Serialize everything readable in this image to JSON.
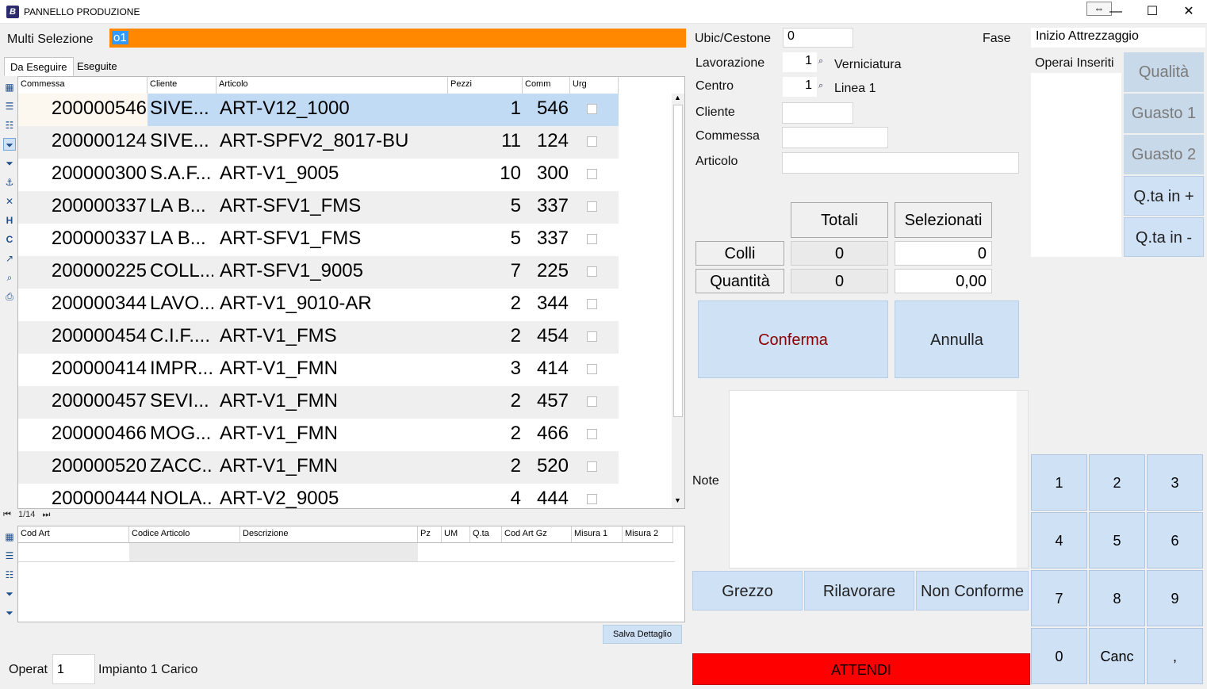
{
  "window": {
    "title": "PANNELLO PRODUZIONE",
    "app_icon_letter": "B",
    "resize_glyph": "⇔",
    "minimize_glyph": "—",
    "maximize_glyph": "☐",
    "close_glyph": "✕"
  },
  "multi": {
    "label": "Multi Selezione",
    "value": "o1",
    "bg_color": "#ff8800"
  },
  "tabs": [
    {
      "label": "Da Eseguire"
    },
    {
      "label": "Eseguite"
    }
  ],
  "toolbar_icons": [
    "grid-icon",
    "list-icon",
    "list-icon",
    "filter-icon",
    "filter-icon",
    "anchor-icon",
    "x-icon",
    "h-icon",
    "c-icon",
    "chart-icon",
    "preview-icon",
    "print-icon"
  ],
  "grid": {
    "columns": [
      "Commessa",
      "Cliente",
      "Articolo",
      "Pezzi",
      "Comm",
      "Urg"
    ],
    "rows": [
      {
        "commessa": "200000546",
        "cliente": "SIVE...",
        "articolo": "ART-V12_1000",
        "pezzi": "1",
        "comm": "546"
      },
      {
        "commessa": "200000124",
        "cliente": "SIVE...",
        "articolo": "ART-SPFV2_8017-BU",
        "pezzi": "11",
        "comm": "124"
      },
      {
        "commessa": "200000300",
        "cliente": "S.A.F...",
        "articolo": "ART-V1_9005",
        "pezzi": "10",
        "comm": "300"
      },
      {
        "commessa": "200000337",
        "cliente": "LA B...",
        "articolo": "ART-SFV1_FMS",
        "pezzi": "5",
        "comm": "337"
      },
      {
        "commessa": "200000337",
        "cliente": "LA B...",
        "articolo": "ART-SFV1_FMS",
        "pezzi": "5",
        "comm": "337"
      },
      {
        "commessa": "200000225",
        "cliente": "COLL...",
        "articolo": "ART-SFV1_9005",
        "pezzi": "7",
        "comm": "225"
      },
      {
        "commessa": "200000344",
        "cliente": "LAVO...",
        "articolo": "ART-V1_9010-AR",
        "pezzi": "2",
        "comm": "344"
      },
      {
        "commessa": "200000454",
        "cliente": "C.I.F....",
        "articolo": "ART-V1_FMS",
        "pezzi": "2",
        "comm": "454"
      },
      {
        "commessa": "200000414",
        "cliente": "IMPR...",
        "articolo": "ART-V1_FMN",
        "pezzi": "3",
        "comm": "414"
      },
      {
        "commessa": "200000457",
        "cliente": "SEVI...",
        "articolo": "ART-V1_FMN",
        "pezzi": "2",
        "comm": "457"
      },
      {
        "commessa": "200000466",
        "cliente": "MOG...",
        "articolo": "ART-V1_FMN",
        "pezzi": "2",
        "comm": "466"
      },
      {
        "commessa": "200000520",
        "cliente": "ZACC...",
        "articolo": "ART-V1_FMN",
        "pezzi": "2",
        "comm": "520"
      },
      {
        "commessa": "200000444",
        "cliente": "NOLA...",
        "articolo": "ART-V2_9005",
        "pezzi": "4",
        "comm": "444"
      }
    ],
    "selected_color": "#c1dbf5"
  },
  "pager": {
    "text": "1/14",
    "first": "⏮",
    "last": "⏭"
  },
  "detail": {
    "columns": [
      "Cod Art",
      "Codice Articolo",
      "Descrizione",
      "Pz",
      "UM",
      "Q.ta",
      "Cod Art Gz",
      "Misura 1",
      "Misura 2"
    ],
    "save_label": "Salva Dettaglio"
  },
  "footer": {
    "operat_label": "Operat",
    "operat_value": "1",
    "impianto": "Impianto 1 Carico"
  },
  "form": {
    "ubic_label": "Ubic/Cestone",
    "ubic_value": "0",
    "fase_label": "Fase",
    "fase_value": "Inizio Attrezzaggio",
    "lavorazione_label": "Lavorazione",
    "lavorazione_value": "1",
    "lavorazione_desc": "Verniciatura",
    "centro_label": "Centro",
    "centro_value": "1",
    "centro_desc": "Linea 1",
    "cliente_label": "Cliente",
    "commessa_label": "Commessa",
    "articolo_label": "Articolo",
    "operai_label": "Operai Inseriti",
    "note_label": "Note"
  },
  "totals": {
    "totali_label": "Totali",
    "selezionati_label": "Selezionati",
    "colli_label": "Colli",
    "quantita_label": "Quantità",
    "colli_tot": "0",
    "colli_sel": "0",
    "qta_tot": "0",
    "qta_sel": "0,00"
  },
  "actions": {
    "conferma": "Conferma",
    "annulla": "Annulla",
    "conferma_color": "#8b0000",
    "grezzo": "Grezzo",
    "rilavorare": "Rilavorare",
    "non_conforme": "Non Conforme",
    "attendi": "ATTENDI",
    "attendi_color": "#ff0000"
  },
  "side_buttons": [
    "Qualità",
    "Guasto 1",
    "Guasto 2",
    "Q.ta in +",
    "Q.ta in -"
  ],
  "keypad": [
    "1",
    "2",
    "3",
    "4",
    "5",
    "6",
    "7",
    "8",
    "9",
    "0",
    "Canc",
    ","
  ]
}
